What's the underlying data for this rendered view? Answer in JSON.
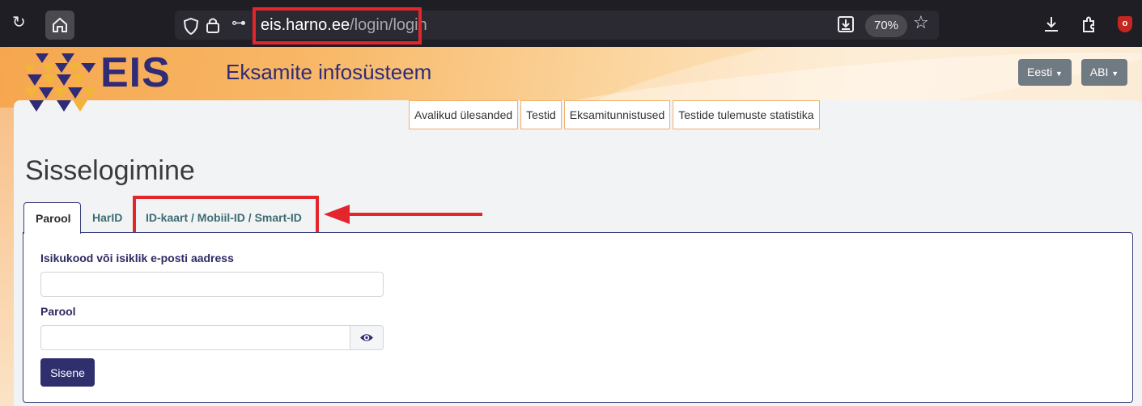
{
  "browser": {
    "url_host": "eis.harno.ee",
    "url_path": "/login/login",
    "zoom": "70%"
  },
  "header": {
    "logo_text": "EIS",
    "site_title": "Eksamite infosüsteem",
    "language_button": "Eesti",
    "help_button": "ABI"
  },
  "nav": {
    "items": [
      {
        "label": "Avalikud ülesanded"
      },
      {
        "label": "Testid"
      },
      {
        "label": "Eksamitunnistused"
      },
      {
        "label": "Testide tulemuste statistika"
      }
    ]
  },
  "page": {
    "title": "Sisselogimine"
  },
  "tabs": [
    {
      "label": "Parool",
      "active": true
    },
    {
      "label": "HarID",
      "active": false
    },
    {
      "label": "ID-kaart / Mobiil-ID / Smart-ID",
      "active": false
    }
  ],
  "form": {
    "id_label": "Isikukood või isiklik e-posti aadress",
    "id_value": "",
    "password_label": "Parool",
    "password_value": "",
    "submit_label": "Sisene"
  },
  "colors": {
    "brand_navy": "#2f2b74",
    "brand_orange": "#f6a64f",
    "annotation_red": "#e3262b"
  }
}
